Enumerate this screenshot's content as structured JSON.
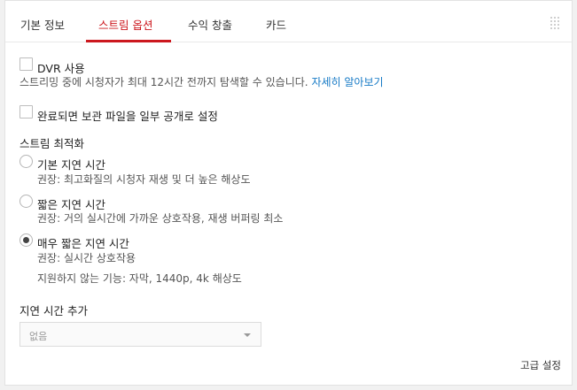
{
  "tabs": [
    {
      "label": "기본 정보"
    },
    {
      "label": "스트림 옵션"
    },
    {
      "label": "수익 창출"
    },
    {
      "label": "카드"
    }
  ],
  "active_tab_index": 1,
  "dvr": {
    "label": "DVR 사용",
    "checked": false,
    "description": "스트리밍 중에 시청자가 최대 12시간 전까지 탐색할 수 있습니다.",
    "link": "자세히 알아보기"
  },
  "archive": {
    "label": "완료되면 보관 파일을 일부 공개로 설정",
    "checked": false
  },
  "optimization": {
    "title": "스트림 최적화",
    "options": [
      {
        "label": "기본 지연 시간",
        "desc": "권장: 최고화질의 시청자 재생 및 더 높은 해상도",
        "selected": false
      },
      {
        "label": "짧은 지연 시간",
        "desc": "권장: 거의 실시간에 가까운 상호작용, 재생 버퍼링 최소",
        "selected": false
      },
      {
        "label": "매우 짧은 지연 시간",
        "desc": "권장: 실시간 상호작용",
        "desc2": "지원하지 않는 기능: 자막, 1440p, 4k 해상도",
        "selected": true
      }
    ]
  },
  "latency": {
    "title": "지연 시간 추가",
    "value": "없음"
  },
  "advanced_link": "고급 설정",
  "colors": {
    "accent": "#cc181e",
    "link": "#167ac6"
  }
}
